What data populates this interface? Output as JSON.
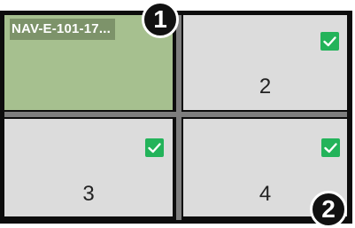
{
  "tiles": [
    {
      "id": 1,
      "title": "NAV-E-101-17...",
      "number": "",
      "selected": true,
      "checked": false
    },
    {
      "id": 2,
      "title": "",
      "number": "2",
      "selected": false,
      "checked": true
    },
    {
      "id": 3,
      "title": "",
      "number": "3",
      "selected": false,
      "checked": true
    },
    {
      "id": 4,
      "title": "",
      "number": "4",
      "selected": false,
      "checked": true
    }
  ],
  "callouts": {
    "first": "1",
    "second": "2"
  },
  "colors": {
    "selected_tile": "#a6c08f",
    "tile": "#dcdcdc",
    "title_badge": "#7d936a",
    "check": "#23b35a",
    "frame": "#0d0d0d"
  },
  "icons": {
    "check": "check-icon"
  }
}
